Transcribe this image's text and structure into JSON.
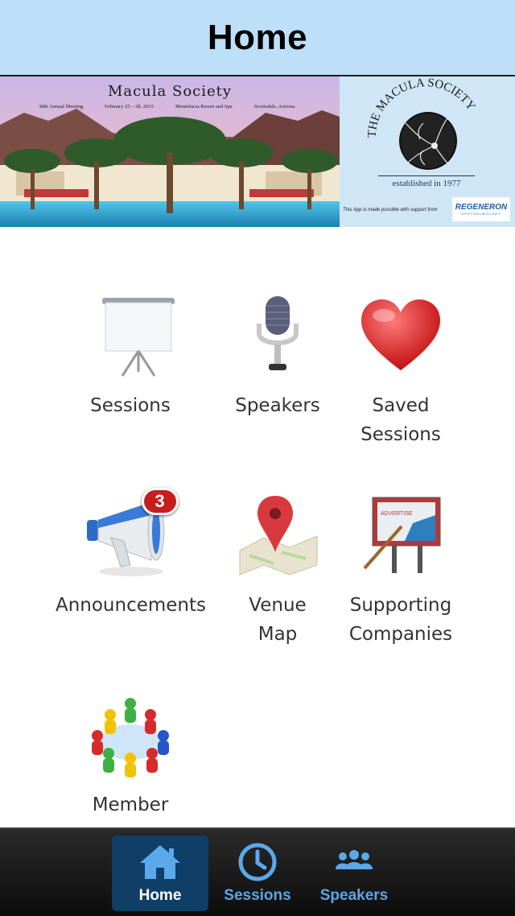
{
  "header": {
    "title": "Home"
  },
  "banner": {
    "title": "Macula Society",
    "meeting": "38th Annual Meeting",
    "dates": "February 25 – 28, 2015",
    "venue": "Montelucia Resort and Spa",
    "location": "Scottsdale, Arizona",
    "logo_text": "THE MACULA SOCIETY",
    "established": "established in 1977",
    "support_text": "This App is made possible with support from",
    "sponsor": "REGENERON",
    "sponsor_sub": "OPHTHALMOLOGY"
  },
  "grid": {
    "items": [
      {
        "label": "Sessions",
        "icon": "projector-screen-icon"
      },
      {
        "label": "Speakers",
        "icon": "microphone-icon"
      },
      {
        "label": "Saved\nSessions",
        "icon": "heart-icon"
      },
      {
        "label": "Announcements",
        "icon": "megaphone-icon",
        "badge": "3"
      },
      {
        "label": "Venue\nMap",
        "icon": "map-pin-icon"
      },
      {
        "label": "Supporting\nCompanies",
        "icon": "billboard-icon"
      },
      {
        "label": "Member",
        "icon": "people-group-icon"
      }
    ]
  },
  "tabbar": {
    "tabs": [
      {
        "label": "Home",
        "icon": "home-icon",
        "active": true
      },
      {
        "label": "Sessions",
        "icon": "clock-icon",
        "active": false
      },
      {
        "label": "Speakers",
        "icon": "people-icon",
        "active": false
      }
    ]
  },
  "colors": {
    "header_bg": "#bde0f8",
    "tab_active_bg": "#0f3f66",
    "tab_label": "#59a7e8",
    "badge": "#c61e1e"
  }
}
